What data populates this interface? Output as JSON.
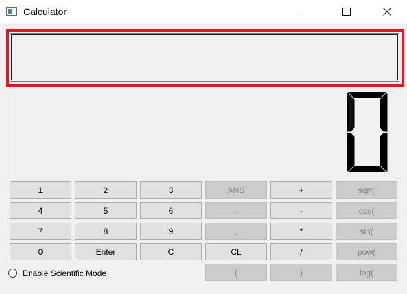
{
  "window": {
    "title": "Calculator",
    "icon": "calculator-app-icon",
    "controls": [
      "minimize-icon",
      "maximize-icon",
      "close-icon"
    ]
  },
  "display": {
    "input_value": "",
    "lcd_value": "0"
  },
  "buttons": {
    "b1": "1",
    "b2": "2",
    "b3": "3",
    "ans": "ANS",
    "plus": "+",
    "sqrt": "sqrt(",
    "b4": "4",
    "b5": "5",
    "b6": "6",
    "dot": ".",
    "minus": "-",
    "cos": "cos(",
    "b7": "7",
    "b8": "8",
    "b9": "9",
    "comma": ",",
    "mul": "*",
    "sin": "sin(",
    "b0": "0",
    "enter": "Enter",
    "c": "C",
    "cl": "CL",
    "div": "/",
    "pow": "pow(",
    "lparen": "(",
    "rparen": ")",
    "log": "log("
  },
  "scientific_mode": {
    "label": "Enable Scientific Mode",
    "checked": false
  },
  "colors": {
    "highlight": "#e8171f",
    "button_bg": "#e1e1e1",
    "button_disabled_bg": "#cccccc",
    "window_bg": "#f0f0f0"
  }
}
